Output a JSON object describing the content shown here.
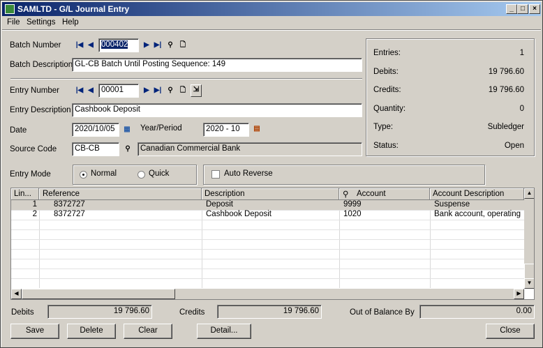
{
  "window": {
    "title": "SAMLTD - G/L Journal Entry"
  },
  "menu": {
    "file": "File",
    "settings": "Settings",
    "help": "Help"
  },
  "batch": {
    "number_label": "Batch Number",
    "number": "000402",
    "description_label": "Batch Description",
    "description": "GL-CB Batch Until Posting Sequence:     149"
  },
  "entry": {
    "number_label": "Entry Number",
    "number": "00001",
    "description_label": "Entry Description",
    "description": "Cashbook Deposit",
    "date_label": "Date",
    "date": "2020/10/05",
    "year_period_label": "Year/Period",
    "year_period": "2020 - 10",
    "source_code_label": "Source Code",
    "source_code": "CB-CB",
    "source_description": "Canadian Commercial Bank",
    "mode_label": "Entry Mode",
    "mode_normal": "Normal",
    "mode_quick": "Quick",
    "auto_reverse": "Auto Reverse"
  },
  "stats": {
    "entries_label": "Entries:",
    "entries": "1",
    "debits_label": "Debits:",
    "debits": "19 796.60",
    "credits_label": "Credits:",
    "credits": "19 796.60",
    "quantity_label": "Quantity:",
    "quantity": "0",
    "type_label": "Type:",
    "type": "Subledger",
    "status_label": "Status:",
    "status": "Open"
  },
  "grid": {
    "columns": [
      "Lin...",
      "Reference",
      "Description",
      "Account",
      "Account Description"
    ],
    "rows": [
      {
        "line": "1",
        "reference": "8372727",
        "description": "Deposit",
        "account": "9999",
        "account_description": "Suspense"
      },
      {
        "line": "2",
        "reference": "8372727",
        "description": "Cashbook Deposit",
        "account": "1020",
        "account_description": "Bank account, operating"
      }
    ]
  },
  "totals": {
    "debits_label": "Debits",
    "debits": "19 796.60",
    "credits_label": "Credits",
    "credits": "19 796.60",
    "oob_label": "Out of Balance By",
    "oob": "0.00"
  },
  "buttons": {
    "save": "Save",
    "delete": "Delete",
    "clear": "Clear",
    "detail": "Detail...",
    "close": "Close"
  },
  "colors": {
    "titlebar": "#0a246a",
    "nav_arrows": "#00247a"
  }
}
